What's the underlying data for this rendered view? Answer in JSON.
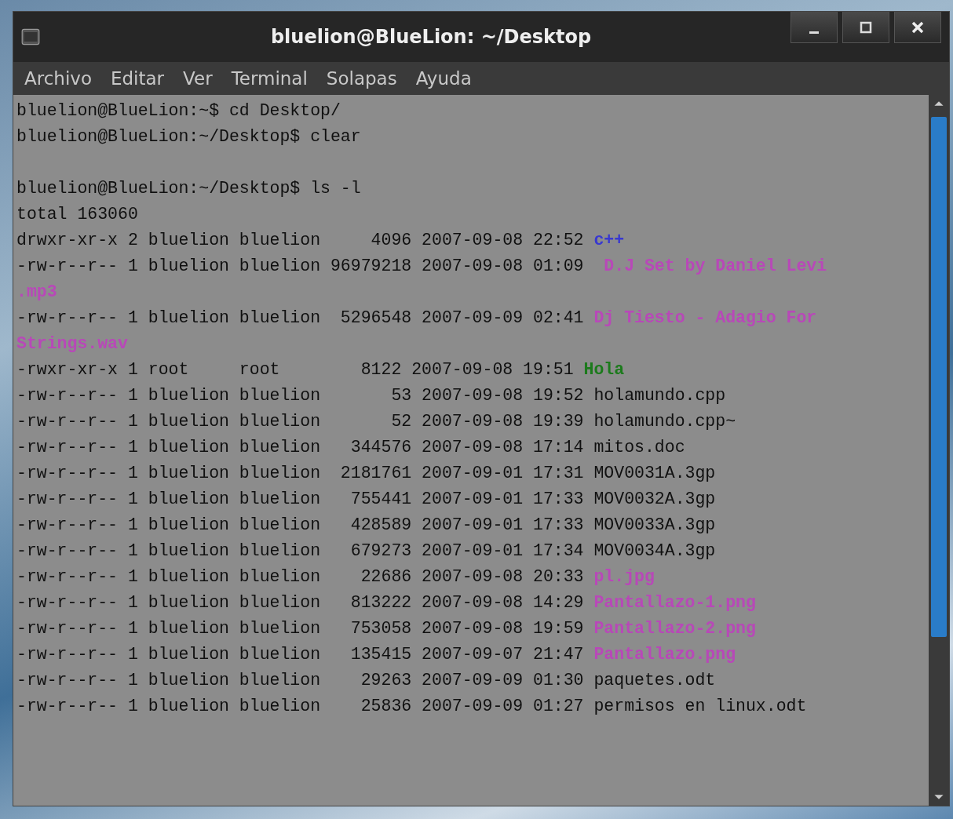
{
  "window": {
    "title": "bluelion@BlueLion: ~/Desktop"
  },
  "menu": [
    "Archivo",
    "Editar",
    "Ver",
    "Terminal",
    "Solapas",
    "Ayuda"
  ],
  "terminal": {
    "lines": [
      {
        "kind": "text",
        "text": "bluelion@BlueLion:~$ cd Desktop/"
      },
      {
        "kind": "text",
        "text": "bluelion@BlueLion:~/Desktop$ clear"
      },
      {
        "kind": "blank"
      },
      {
        "kind": "text",
        "text": "bluelion@BlueLion:~/Desktop$ ls -l"
      },
      {
        "kind": "text",
        "text": "total 163060"
      },
      {
        "kind": "file",
        "meta": "drwxr-xr-x 2 bluelion bluelion     4096 2007-09-08 22:52",
        "name": "c++",
        "color": "#3838d0"
      },
      {
        "kind": "file",
        "meta": "-rw-r--r-- 1 bluelion bluelion 96979218 2007-09-08 01:09",
        "name": " D.J Set by Daniel Levi",
        "wrap": ".mp3",
        "color": "#b848b8"
      },
      {
        "kind": "file",
        "meta": "-rw-r--r-- 1 bluelion bluelion  5296548 2007-09-09 02:41",
        "name": "Dj Tiesto - Adagio For",
        "wrap": "Strings.wav",
        "color": "#b848b8"
      },
      {
        "kind": "file",
        "meta": "-rwxr-xr-x 1 root     root        8122 2007-09-08 19:51",
        "name": "Hola",
        "color": "#1c7a1c"
      },
      {
        "kind": "file",
        "meta": "-rw-r--r-- 1 bluelion bluelion       53 2007-09-08 19:52",
        "name": "holamundo.cpp",
        "color": "#101010"
      },
      {
        "kind": "file",
        "meta": "-rw-r--r-- 1 bluelion bluelion       52 2007-09-08 19:39",
        "name": "holamundo.cpp~",
        "color": "#101010"
      },
      {
        "kind": "file",
        "meta": "-rw-r--r-- 1 bluelion bluelion   344576 2007-09-08 17:14",
        "name": "mitos.doc",
        "color": "#101010"
      },
      {
        "kind": "file",
        "meta": "-rw-r--r-- 1 bluelion bluelion  2181761 2007-09-01 17:31",
        "name": "MOV0031A.3gp",
        "color": "#101010"
      },
      {
        "kind": "file",
        "meta": "-rw-r--r-- 1 bluelion bluelion   755441 2007-09-01 17:33",
        "name": "MOV0032A.3gp",
        "color": "#101010"
      },
      {
        "kind": "file",
        "meta": "-rw-r--r-- 1 bluelion bluelion   428589 2007-09-01 17:33",
        "name": "MOV0033A.3gp",
        "color": "#101010"
      },
      {
        "kind": "file",
        "meta": "-rw-r--r-- 1 bluelion bluelion   679273 2007-09-01 17:34",
        "name": "MOV0034A.3gp",
        "color": "#101010"
      },
      {
        "kind": "file",
        "meta": "-rw-r--r-- 1 bluelion bluelion    22686 2007-09-08 20:33",
        "name": "pl.jpg",
        "color": "#b848b8"
      },
      {
        "kind": "file",
        "meta": "-rw-r--r-- 1 bluelion bluelion   813222 2007-09-08 14:29",
        "name": "Pantallazo-1.png",
        "color": "#b848b8"
      },
      {
        "kind": "file",
        "meta": "-rw-r--r-- 1 bluelion bluelion   753058 2007-09-08 19:59",
        "name": "Pantallazo-2.png",
        "color": "#b848b8"
      },
      {
        "kind": "file",
        "meta": "-rw-r--r-- 1 bluelion bluelion   135415 2007-09-07 21:47",
        "name": "Pantallazo.png",
        "color": "#b848b8"
      },
      {
        "kind": "file",
        "meta": "-rw-r--r-- 1 bluelion bluelion    29263 2007-09-09 01:30",
        "name": "paquetes.odt",
        "color": "#101010"
      },
      {
        "kind": "file",
        "meta": "-rw-r--r-- 1 bluelion bluelion    25836 2007-09-09 01:27",
        "name": "permisos en linux.odt",
        "color": "#101010"
      }
    ]
  }
}
